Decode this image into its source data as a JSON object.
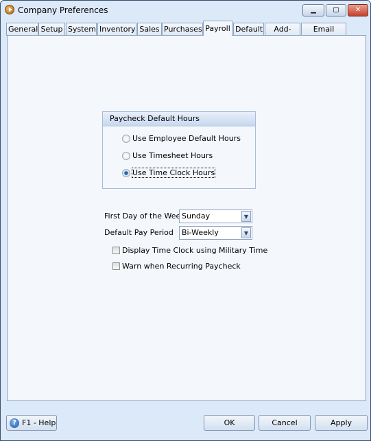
{
  "window": {
    "title": "Company Preferences",
    "icon": "app-logo-icon"
  },
  "tabs": [
    {
      "label": "General"
    },
    {
      "label": "Setup"
    },
    {
      "label": "System"
    },
    {
      "label": "Inventory"
    },
    {
      "label": "Sales"
    },
    {
      "label": "Purchases"
    },
    {
      "label": "Payroll",
      "active": true
    },
    {
      "label": "Default"
    },
    {
      "label": "Add-Ons"
    },
    {
      "label": "Email Setup"
    }
  ],
  "paycheck_group": {
    "title": "Paycheck Default Hours",
    "options": [
      {
        "label": "Use Employee Default Hours",
        "selected": false
      },
      {
        "label": "Use Timesheet Hours",
        "selected": false
      },
      {
        "label": "Use Time Clock Hours",
        "selected": true
      }
    ]
  },
  "fields": {
    "first_day_label": "First Day of the Week",
    "first_day_value": "Sunday",
    "pay_period_label": "Default Pay Period",
    "pay_period_value": "Bi-Weekly"
  },
  "checkboxes": [
    {
      "label": "Display Time Clock using Military Time",
      "checked": false
    },
    {
      "label": "Warn when Recurring Paycheck",
      "checked": false
    }
  ],
  "buttons": {
    "help": "F1 - Help",
    "ok": "OK",
    "cancel": "Cancel",
    "apply": "Apply"
  }
}
